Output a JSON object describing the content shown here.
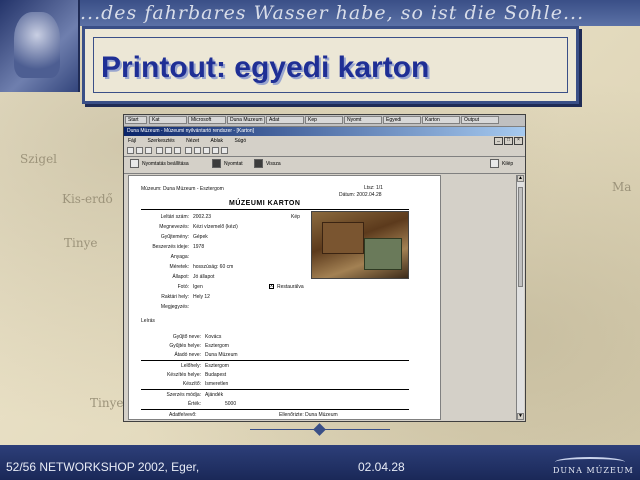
{
  "slide": {
    "header_script": "...des fahrbares Wasser habe, so ist die Sohle...",
    "title": "Printout: egyedi karton",
    "footer_left": "52/56 NETWORKSHOP 2002, Eger,",
    "footer_date": "02.04.28",
    "logo_text": "DUNA MÚZEUM",
    "map_labels": [
      "Szigel",
      "Kis-erdő",
      "Tinye",
      "Tinye",
      "Ma"
    ]
  },
  "window": {
    "taskbar": [
      "Start",
      "Kat",
      "Microsoft",
      "Duna Muzeum",
      "Adat",
      "Kep",
      "Nyomt",
      "Egyedi",
      "Karton",
      "Output"
    ],
    "title": "Duna Múzeum - Múzeumi nyilvántartó rendszer - [Karton]",
    "menu": [
      "Fájl",
      "Szerkesztés",
      "Nézet",
      "Ablak",
      "Súgó"
    ],
    "actions": {
      "first": "Nyomtatás beállítása",
      "second": "Nyomtat",
      "third": "Vissza",
      "right": "Kilép"
    }
  },
  "card": {
    "top_left": "Múzeum: Duna Múzeum - Esztergom",
    "top_right_1": "Ltsz: 1/1",
    "top_right_2": "Dátum: 2002.04.28",
    "title": "MÚZEUMI KARTON",
    "rows": [
      {
        "label": "Leltári szám:",
        "value": "2002.23"
      },
      {
        "label": "Megnevezés:",
        "value": "Kézi vízemelő (kézi)"
      },
      {
        "label": "Gyűjtemény:",
        "value": "Gépek"
      },
      {
        "label": "Beszerzés ideje:",
        "value": "1978"
      },
      {
        "label": "Anyaga:",
        "value": ""
      },
      {
        "label": "Méretek:",
        "value": "hosszúság: 60 cm"
      },
      {
        "label": "Állapot:",
        "value": "Jó állapot"
      },
      {
        "label": "Fotó:",
        "value": "Igen"
      },
      {
        "label": "Raktári hely:",
        "value": "Hely 12"
      },
      {
        "label": "Megjegyzés:",
        "value": ""
      }
    ],
    "photo_label": "Kép",
    "checkbox_label": "Restaurálva",
    "section_label": "Leírás",
    "rows2": [
      {
        "label": "Gyűjtő neve:",
        "value": "Kovács"
      },
      {
        "label": "Gyűjtés helye:",
        "value": "Esztergom"
      },
      {
        "label": "Átadó neve:",
        "value": "Duna Múzeum"
      }
    ],
    "rows3": [
      {
        "label": "Lelőhely:",
        "value": "Esztergom"
      },
      {
        "label": "Készítés helye:",
        "value": "Budapest"
      },
      {
        "label": "Készítő:",
        "value": "Ismeretlen"
      }
    ],
    "rows4": [
      {
        "label": "Szerzés módja:",
        "value": "Ajándék"
      },
      {
        "label": "Érték:",
        "value": "5000"
      }
    ],
    "bottom_left": "Adatfelvevő:",
    "bottom_right": "Ellenőrizte: Duna Múzeum"
  }
}
